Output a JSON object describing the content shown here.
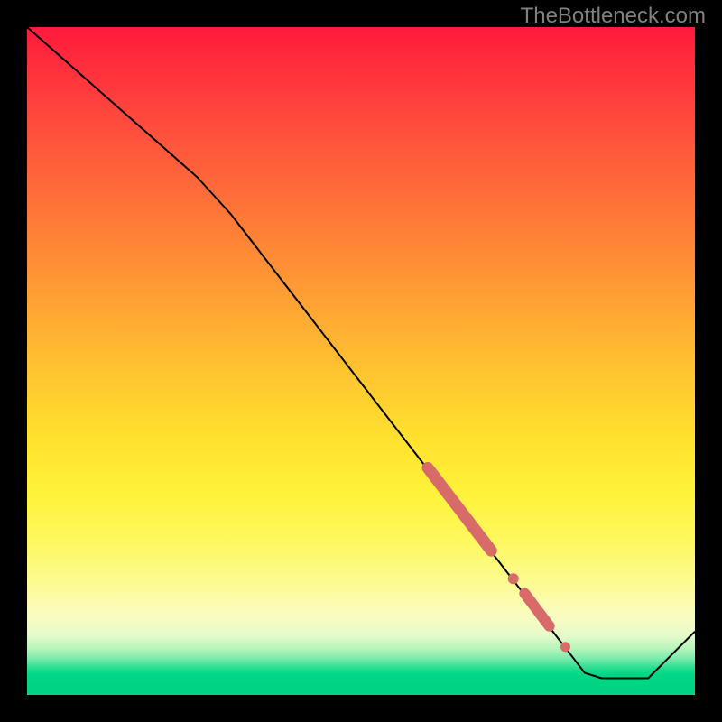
{
  "attribution": "TheBottleneck.com",
  "chart_data": {
    "type": "line",
    "title": "",
    "xlabel": "",
    "ylabel": "",
    "xlim": [
      0,
      100
    ],
    "ylim": [
      0,
      100
    ],
    "grid": false,
    "legend": false,
    "note": "Axes are unlabeled; x and y expressed as 0–100 percent of the plot area. y=0 is the bottom (green) edge, y=100 is the top (red) edge.",
    "series": [
      {
        "name": "main-curve",
        "stroke": "#000000",
        "width": 2,
        "points": [
          {
            "x": 0.0,
            "y": 100.0
          },
          {
            "x": 25.5,
            "y": 77.5
          },
          {
            "x": 30.5,
            "y": 72.0
          },
          {
            "x": 83.5,
            "y": 3.3
          },
          {
            "x": 86.0,
            "y": 2.5
          },
          {
            "x": 93.0,
            "y": 2.5
          },
          {
            "x": 100.0,
            "y": 9.5
          }
        ]
      }
    ],
    "markers": [
      {
        "name": "thick-red-segment-upper",
        "type": "segment",
        "stroke": "#d96a6a",
        "width": 13,
        "cap": "round",
        "from": {
          "x": 60.0,
          "y": 34.0
        },
        "to": {
          "x": 69.5,
          "y": 21.6
        }
      },
      {
        "name": "red-dot-mid",
        "type": "dot",
        "fill": "#d96a6a",
        "r": 6,
        "at": {
          "x": 72.8,
          "y": 17.4
        }
      },
      {
        "name": "thick-red-segment-lower",
        "type": "segment",
        "stroke": "#d96a6a",
        "width": 12,
        "cap": "round",
        "from": {
          "x": 74.5,
          "y": 15.2
        },
        "to": {
          "x": 78.2,
          "y": 10.3
        }
      },
      {
        "name": "red-dot-low",
        "type": "dot",
        "fill": "#d96a6a",
        "r": 5.5,
        "at": {
          "x": 80.6,
          "y": 7.2
        }
      }
    ],
    "background_gradient": {
      "direction": "vertical",
      "stops": [
        {
          "pos": 0.0,
          "color": "#ff1a3c"
        },
        {
          "pos": 0.24,
          "color": "#ff6a3a"
        },
        {
          "pos": 0.53,
          "color": "#ffc830"
        },
        {
          "pos": 0.77,
          "color": "#fdf85f"
        },
        {
          "pos": 0.91,
          "color": "#e8fbca"
        },
        {
          "pos": 0.97,
          "color": "#00d684"
        },
        {
          "pos": 1.0,
          "color": "#00d381"
        }
      ]
    }
  }
}
